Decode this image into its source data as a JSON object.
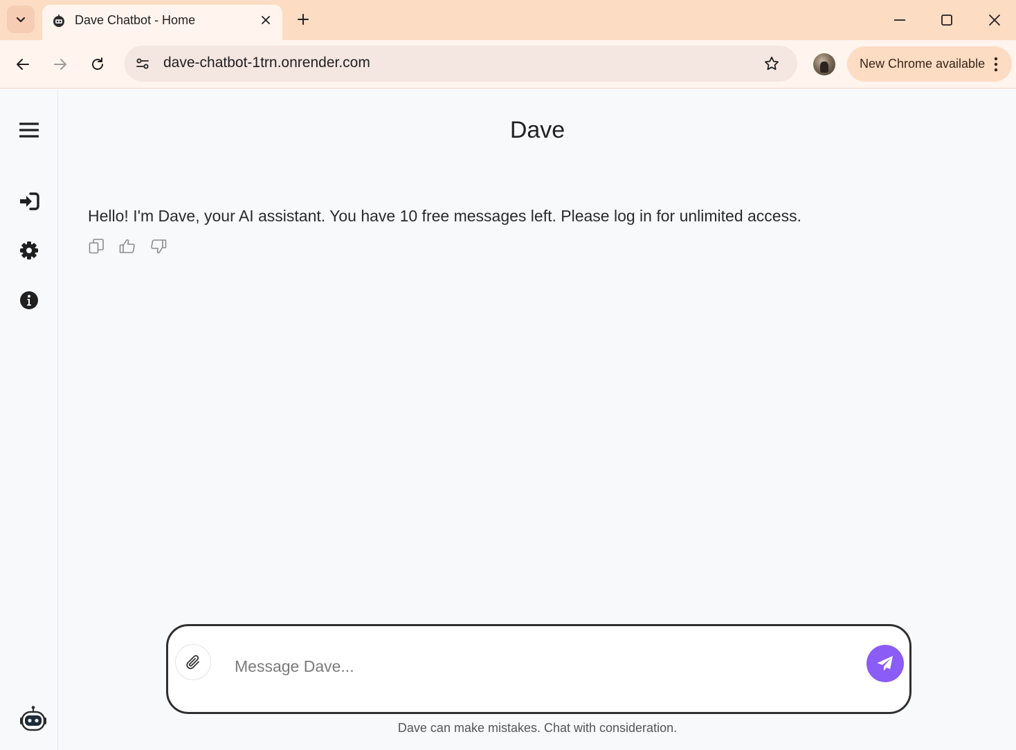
{
  "browser": {
    "tab": {
      "title": "Dave Chatbot - Home"
    },
    "address_bar": {
      "url": "dave-chatbot-1trn.onrender.com"
    },
    "update_button": {
      "label": "New Chrome available"
    }
  },
  "app": {
    "title": "Dave",
    "messages": [
      {
        "role": "assistant",
        "text": "Hello! I'm Dave, your AI assistant. You have 10 free messages left. Please log in for unlimited access."
      }
    ],
    "composer": {
      "placeholder": "Message Dave...",
      "value": ""
    },
    "disclaimer": "Dave can make mistakes. Chat with consideration.",
    "colors": {
      "accent": "#8b5cf6",
      "tabstrip": "#fddcc4",
      "toolbar": "#fff4ee",
      "background": "#f8f9fb"
    }
  }
}
